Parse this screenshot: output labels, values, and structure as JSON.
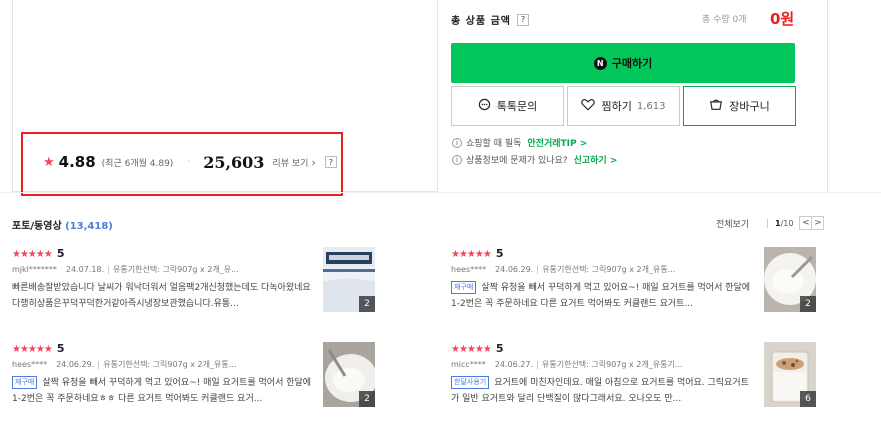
{
  "summary": {
    "total_label": "총 상품 금액",
    "qmark": "?",
    "qty_text": "총 수량 0개",
    "price": "0원"
  },
  "buttons": {
    "buy_logo": "N",
    "buy": "구매하기",
    "talk": "톡톡문의",
    "zzim": "찜하기",
    "zzim_count": "1,613",
    "cart": "장바구니"
  },
  "info": {
    "line1_text": "쇼핑할 때 필독",
    "line1_link": "안전거래TIP >",
    "line2_text": "상품정보에 문제가 있나요?",
    "line2_link": "신고하기 >"
  },
  "rating": {
    "score": "4.88",
    "recent": "(최근 6개월 4.89)",
    "dot": "·",
    "count": "25,603",
    "link": "리뷰 보기",
    "qmark": "?"
  },
  "photo_reviews": {
    "title": "포토/동영상",
    "count": "(13,418)",
    "see_all": "전체보기",
    "page_current": "1",
    "page_total": "/10",
    "prev": "<",
    "next": ">"
  },
  "reviews": [
    {
      "stars": "★★★★★",
      "score": "5",
      "user": "mjkl*******",
      "date": "24.07.18.",
      "option": "유통기한선택: 그릭907g x 2개_유...",
      "tag": "",
      "text": "빠른배송잘받았습니다 날씨가 워낙더워서 얼음팩2개신청했는데도 다녹아왔네요 다행히상품은꾸덕꾸덕한거같아즉시냉장보관했습니다.유통...",
      "photo_count": "2"
    },
    {
      "stars": "★★★★★",
      "score": "5",
      "user": "hees****",
      "date": "24.06.29.",
      "option": "유통기한선택: 그릭907g x 2개_유통...",
      "tag": "재구매",
      "text": "살짝 유청을 빼서 꾸덕하게 먹고 있어요~! 매일 요거트를 먹어서 한달에 1-2번은 꼭 주문하네요 다른 요거트 먹어봐도 커클랜드 요거트...",
      "photo_count": "2"
    },
    {
      "stars": "★★★★★",
      "score": "5",
      "user": "hees****",
      "date": "24.06.29.",
      "option": "유통기한선택: 그릭907g x 2개_유통...",
      "tag": "재구매",
      "text": "살짝 유청을 빼서 꾸덕하게 먹고 있어요~! 매일 요거트를 먹어서 한달에 1-2번은 꼭 주문하네요ㅎㅎ 다른 요거트 먹어봐도 커클랜드 요거...",
      "photo_count": "2"
    },
    {
      "stars": "★★★★★",
      "score": "5",
      "user": "micc****",
      "date": "24.06.27.",
      "option": "유통기한선택: 그릭907g x 2개_유통기...",
      "tag": "한달사용기",
      "text": "요거트에 미친자인데요. 매일 아침으로 요거트를 먹어요. 그릭요거트가 일반 요거트와 달리 단백질이 많다그래서요. 오나오도 만...",
      "photo_count": "6"
    }
  ]
}
